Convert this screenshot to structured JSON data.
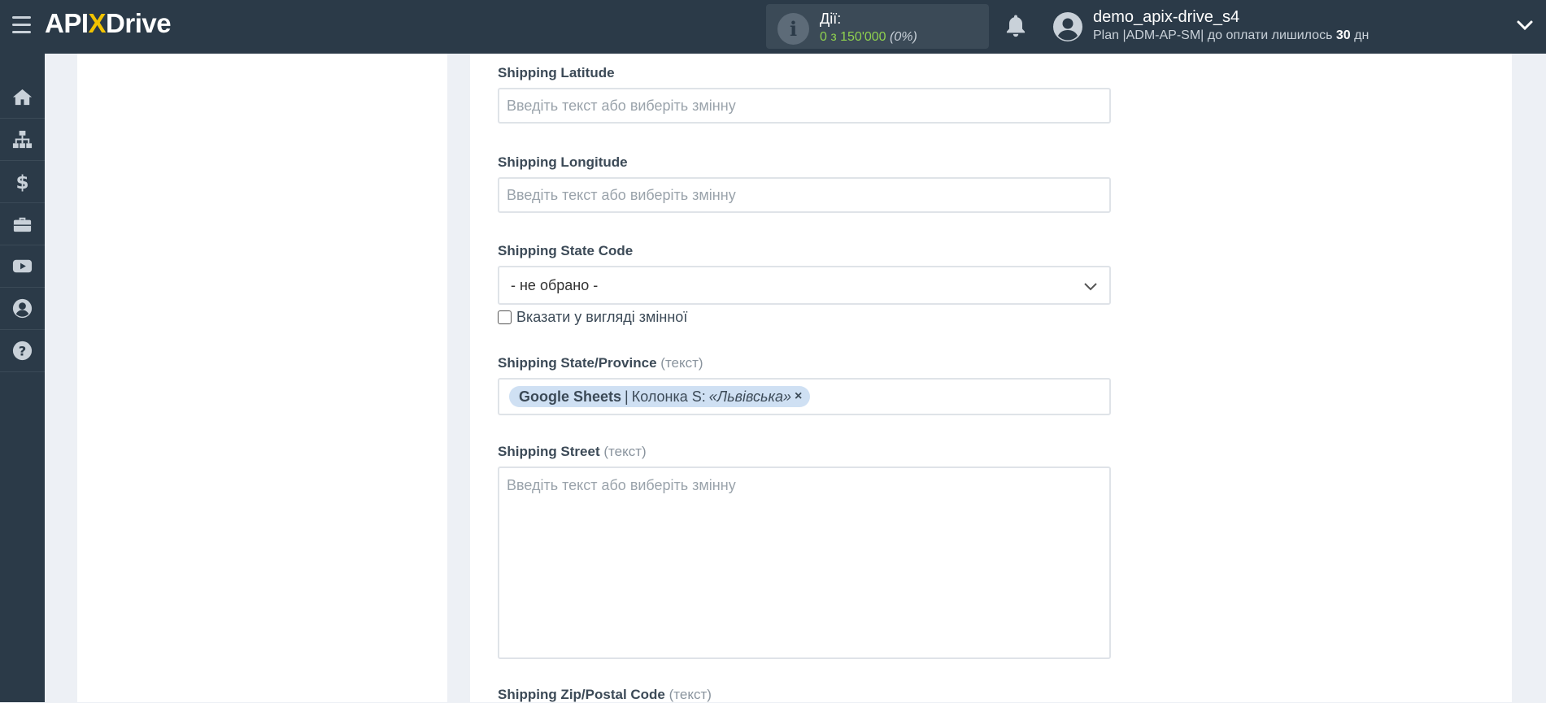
{
  "header": {
    "logo": {
      "part1": "API",
      "x": "X",
      "part2": "Drive"
    },
    "actions": {
      "label": "Дії:",
      "value": "0 з 150'000",
      "percent": "(0%)"
    },
    "user": {
      "name": "demo_apix-drive_s4",
      "plan_prefix": "Plan |ADM-AP-SM| до оплати лишилось ",
      "plan_days": "30",
      "plan_suffix": " дн"
    }
  },
  "sidebar": {
    "items": [
      {
        "icon": "home-icon"
      },
      {
        "icon": "sitemap-icon"
      },
      {
        "icon": "dollar-icon"
      },
      {
        "icon": "briefcase-icon"
      },
      {
        "icon": "youtube-icon"
      },
      {
        "icon": "user-circle-icon"
      },
      {
        "icon": "question-circle-icon"
      }
    ]
  },
  "form": {
    "shipping_latitude": {
      "label": "Shipping Latitude",
      "placeholder": "Введіть текст або виберіть змінну",
      "value": ""
    },
    "shipping_longitude": {
      "label": "Shipping Longitude",
      "placeholder": "Введіть текст або виберіть змінну",
      "value": ""
    },
    "shipping_state_code": {
      "label": "Shipping State Code",
      "selected": "- не обрано -",
      "checkbox_label": "Вказати у вигляді змінної",
      "checked": false
    },
    "shipping_state_province": {
      "label": "Shipping State/Province",
      "hint": "(текст)",
      "tag": {
        "source": "Google Sheets",
        "column": "Колонка S:",
        "value": "«Львівська»",
        "remove": "×"
      }
    },
    "shipping_street": {
      "label": "Shipping Street",
      "hint": "(текст)",
      "placeholder": "Введіть текст або виберіть змінну"
    },
    "shipping_zip": {
      "label": "Shipping Zip/Postal Code",
      "hint": "(текст)"
    }
  },
  "colors": {
    "topbar": "#2b3a48",
    "accent_yellow": "#f2c300",
    "actions_green": "#8fd14f",
    "tag_bg": "#cfe0f3"
  }
}
